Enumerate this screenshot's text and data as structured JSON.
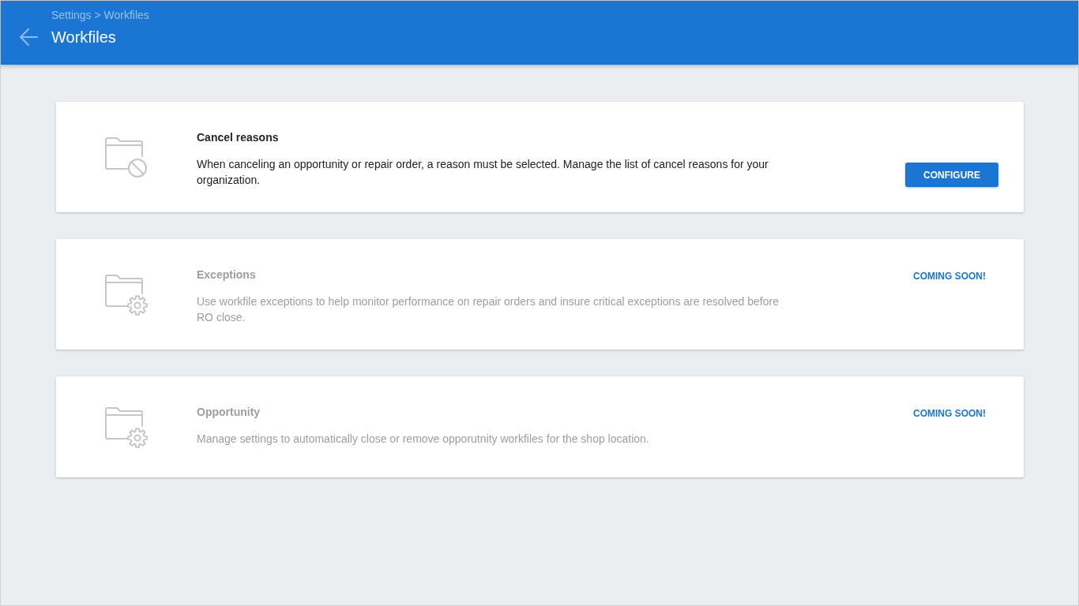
{
  "header": {
    "breadcrumb": "Settings > Workfiles",
    "title": "Workfiles"
  },
  "cards": [
    {
      "kind": "configurable",
      "disabled": false,
      "title": "Cancel reasons",
      "description": "When canceling an opportunity or repair order, a reason must be selected. Manage the list of cancel reasons for your organization.",
      "action": "CONFIGURE"
    },
    {
      "kind": "upcoming",
      "disabled": true,
      "title": "Exceptions",
      "description": "Use workfile exceptions to help monitor performance on repair orders and insure critical exceptions are resolved before RO close.",
      "action": "COMING SOON!"
    },
    {
      "kind": "upcoming",
      "disabled": true,
      "title": "Opportunity",
      "description": "Manage settings to automatically close or remove opporutnity workfiles for the shop location.",
      "action": "COMING SOON!"
    }
  ]
}
